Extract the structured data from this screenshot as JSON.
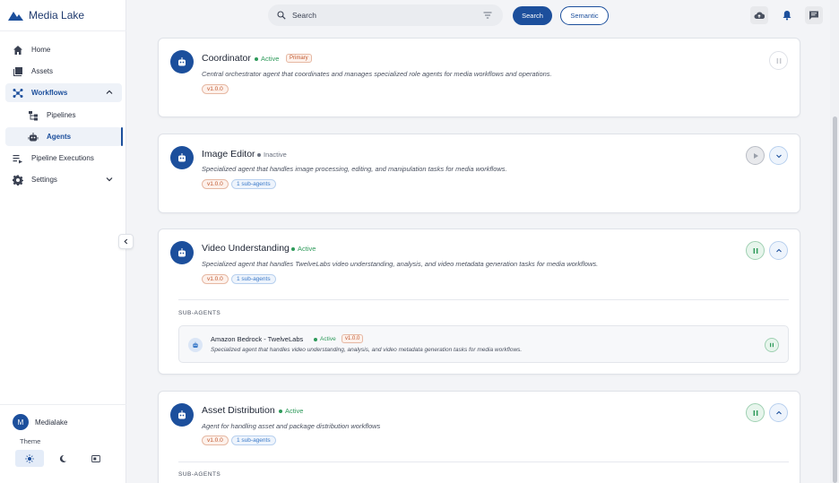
{
  "app": {
    "title": "Media Lake"
  },
  "sidebar": {
    "items": [
      {
        "label": "Home",
        "icon": "home-icon"
      },
      {
        "label": "Assets",
        "icon": "assets-icon"
      },
      {
        "label": "Workflows",
        "icon": "workflows-icon",
        "expanded": true
      },
      {
        "label": "Pipelines",
        "icon": "pipelines-icon"
      },
      {
        "label": "Agents",
        "icon": "robot-icon",
        "selected": true
      },
      {
        "label": "Pipeline Executions",
        "icon": "executions-icon"
      },
      {
        "label": "Settings",
        "icon": "gear-icon",
        "expanded": false
      }
    ],
    "user": {
      "initial": "M",
      "name": "Medialake"
    },
    "theme_label": "Theme"
  },
  "topbar": {
    "search_placeholder": "Search",
    "search_button": "Search",
    "semantic_button": "Semantic"
  },
  "agents": [
    {
      "name": "Coordinator",
      "status": "Active",
      "badge": "Primary",
      "description": "Central orchestrator agent that coordinates and manages specialized role agents for media workflows and operations.",
      "version": "v1.0.0",
      "sub_agents_label": ""
    },
    {
      "name": "Image Editor",
      "status": "Inactive",
      "description": "Specialized agent that handles image processing, editing, and manipulation tasks for media workflows.",
      "version": "v1.0.0",
      "sub_agents_label": "1 sub-agents"
    },
    {
      "name": "Video Understanding",
      "status": "Active",
      "description": "Specialized agent that handles TwelveLabs video understanding, analysis, and video metadata generation tasks for media workflows.",
      "version": "v1.0.0",
      "sub_agents_label": "1 sub-agents",
      "sub_heading": "SUB-AGENTS",
      "sub_agents": [
        {
          "name": "Amazon Bedrock - TwelveLabs",
          "status": "Active",
          "version": "v1.0.0",
          "description": "Specialized agent that handles video understanding, analysis, and video metadata generation tasks for media workflows."
        }
      ]
    },
    {
      "name": "Asset Distribution",
      "status": "Active",
      "description": "Agent for handling asset and package distribution workflows",
      "version": "v1.0.0",
      "sub_agents_label": "1 sub-agents",
      "sub_heading": "SUB-AGENTS"
    }
  ],
  "colors": {
    "accent": "#1c4f9c",
    "active": "#2e9a5a",
    "version": "#c0572e",
    "sub_chip": "#3b7ac9"
  }
}
